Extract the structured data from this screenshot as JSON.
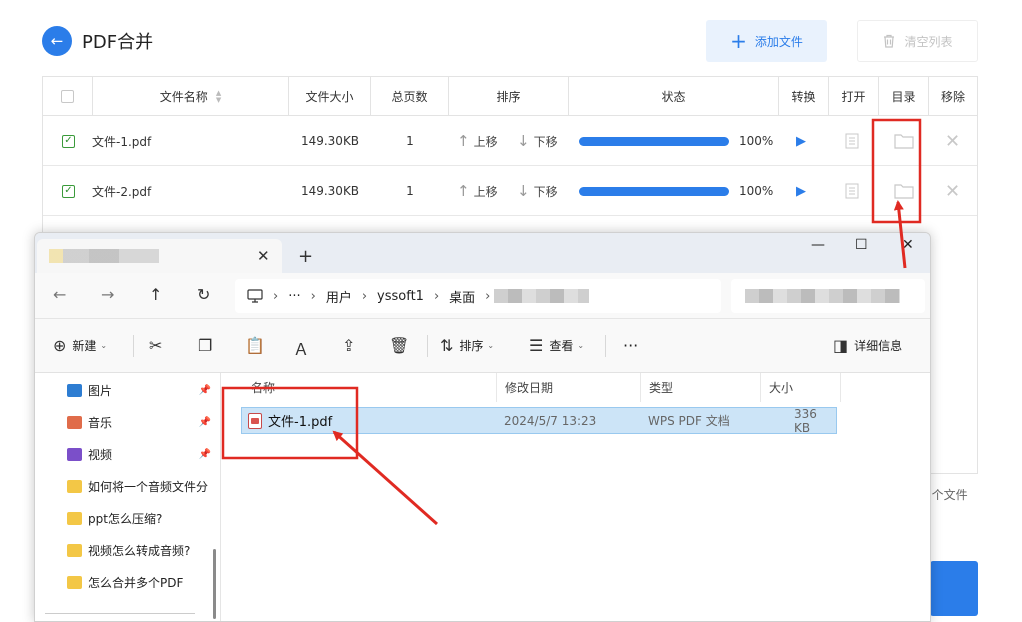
{
  "app": {
    "title": "PDF合并",
    "back_icon": "arrow-left-icon",
    "add_button": "添加文件",
    "clear_button": "清空列表",
    "columns": [
      "文件名称",
      "文件大小",
      "总页数",
      "排序",
      "状态",
      "转换",
      "打开",
      "目录",
      "移除"
    ],
    "rows": [
      {
        "name": "文件-1.pdf",
        "size": "149.30KB",
        "pages": "1",
        "up": "上移",
        "down": "下移",
        "progress": 100,
        "percent": "100%"
      },
      {
        "name": "文件-2.pdf",
        "size": "149.30KB",
        "pages": "1",
        "up": "上移",
        "down": "下移",
        "progress": 100,
        "percent": "100%"
      }
    ],
    "footer_count": "2个文件",
    "accent": "#2b7de9"
  },
  "explorer": {
    "tab_close": "✕",
    "tab_add": "+",
    "win_minimize": "—",
    "win_maximize": "☐",
    "win_close": "✕",
    "breadcrumb": [
      "用户",
      "yssoft1",
      "桌面"
    ],
    "breadcrumb_more": "···",
    "toolbar": {
      "new": "新建",
      "sort": "排序",
      "view": "查看",
      "more": "···",
      "details": "详细信息"
    },
    "sidebar": [
      {
        "label": "图片",
        "color": "#2d7dd2",
        "pinned": true
      },
      {
        "label": "音乐",
        "color": "#e06c4a",
        "pinned": true
      },
      {
        "label": "视频",
        "color": "#7b4fc9",
        "pinned": true
      },
      {
        "label": "如何将一个音频文件分",
        "color": "#f3c746",
        "pinned": false
      },
      {
        "label": "ppt怎么压缩?",
        "color": "#f3c746",
        "pinned": false
      },
      {
        "label": "视频怎么转成音频?",
        "color": "#f3c746",
        "pinned": false
      },
      {
        "label": "怎么合并多个PDF",
        "color": "#f3c746",
        "pinned": false
      }
    ],
    "file_columns": [
      "名称",
      "修改日期",
      "类型",
      "大小"
    ],
    "file": {
      "name": "文件-1.pdf",
      "modified": "2024/5/7 13:23",
      "type": "WPS PDF 文档",
      "size": "336 KB"
    }
  },
  "annotation_color": "#e02a22"
}
